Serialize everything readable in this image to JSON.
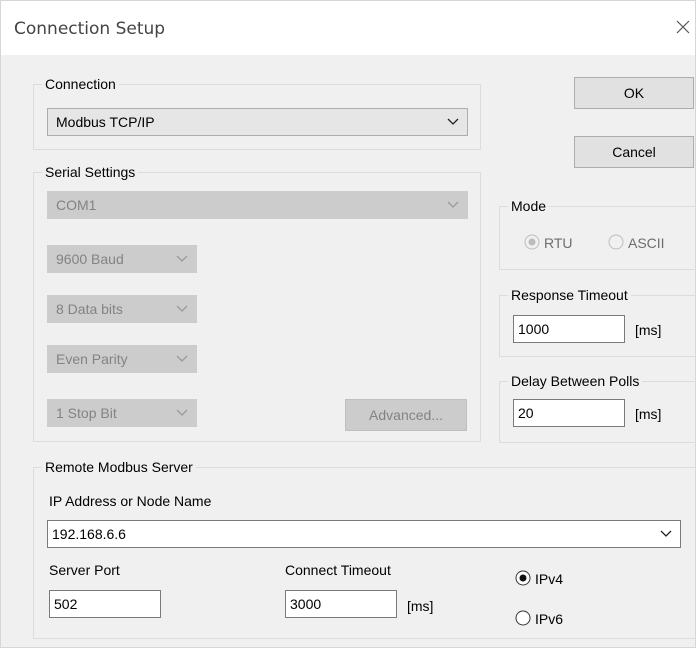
{
  "title": "Connection Setup",
  "buttons": {
    "ok": "OK",
    "cancel": "Cancel",
    "advanced": "Advanced..."
  },
  "connection": {
    "label": "Connection",
    "value": "Modbus TCP/IP"
  },
  "serial": {
    "label": "Serial Settings",
    "port": "COM1",
    "baud": "9600 Baud",
    "data_bits": "8 Data bits",
    "parity": "Even Parity",
    "stop_bits": "1 Stop Bit"
  },
  "mode": {
    "label": "Mode",
    "rtu": "RTU",
    "ascii": "ASCII",
    "selected": "RTU",
    "enabled": false
  },
  "response_timeout": {
    "label": "Response Timeout",
    "value": "1000",
    "unit": "[ms]"
  },
  "delay_between_polls": {
    "label": "Delay Between Polls",
    "value": "20",
    "unit": "[ms]"
  },
  "remote": {
    "label": "Remote Modbus Server",
    "address_label": "IP Address or Node Name",
    "address": "192.168.6.6",
    "port_label": "Server Port",
    "port": "502",
    "connect_timeout_label": "Connect Timeout",
    "connect_timeout": "3000",
    "connect_timeout_unit": "[ms]",
    "ipv4": "IPv4",
    "ipv6": "IPv6",
    "selected_ip": "IPv4"
  }
}
